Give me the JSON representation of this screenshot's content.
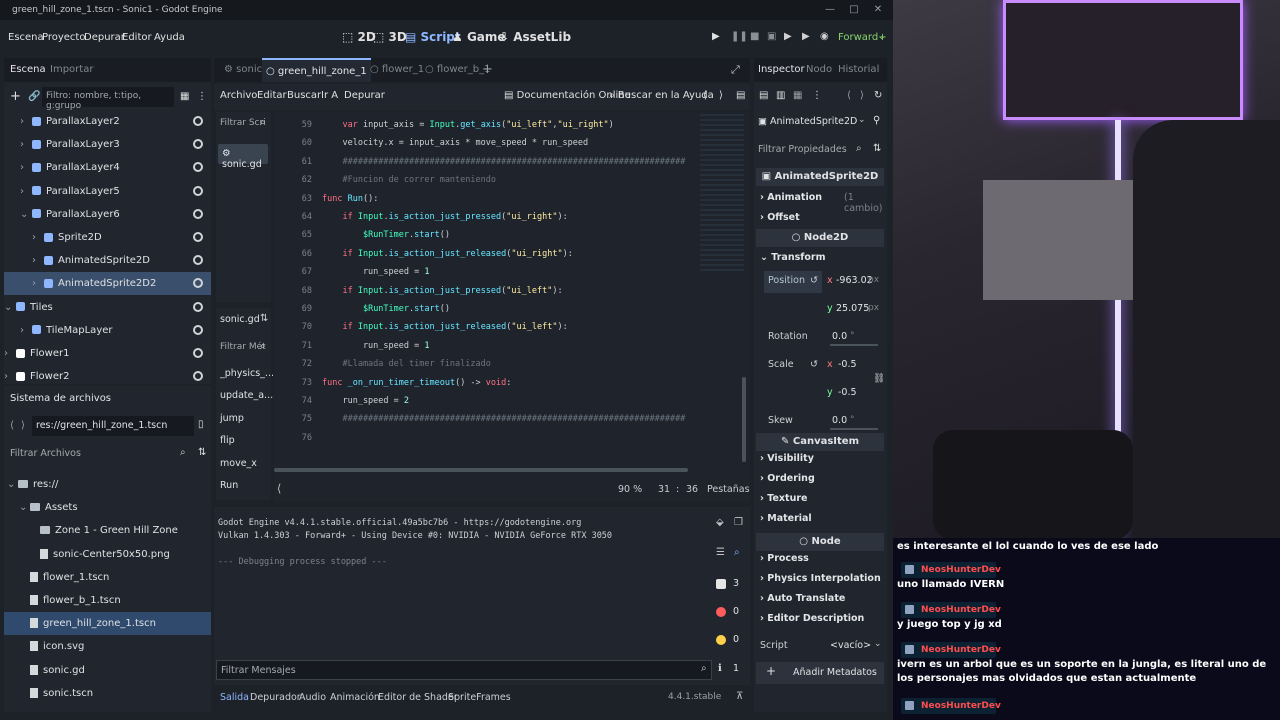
{
  "window": {
    "title": "green_hill_zone_1.tscn - Sonic1 - Godot Engine"
  },
  "menu": [
    "Escena",
    "Proyecto",
    "Depurar",
    "Editor",
    "Ayuda"
  ],
  "workspaces": [
    "2D",
    "3D",
    "Script",
    "Game",
    "AssetLib"
  ],
  "renderer": "Forward+",
  "scene_panel": {
    "tabs": [
      "Escena",
      "Importar"
    ],
    "filter_placeholder": "Filtro: nombre, t:tipo, g:grupo",
    "nodes": [
      "ParallaxLayer2",
      "ParallaxLayer3",
      "ParallaxLayer4",
      "ParallaxLayer5",
      "ParallaxLayer6",
      "Sprite2D",
      "AnimatedSprite2D",
      "AnimatedSprite2D2",
      "Tiles",
      "TileMapLayer",
      "Flower1",
      "Flower2"
    ]
  },
  "filesystem": {
    "title": "Sistema de archivos",
    "path": "res://green_hill_zone_1.tscn",
    "filter_placeholder": "Filtrar Archivos",
    "items": [
      "res://",
      "Assets",
      "Zone 1 - Green Hill Zone",
      "sonic-Center50x50.png",
      "flower_1.tscn",
      "flower_b_1.tscn",
      "green_hill_zone_1.tscn",
      "icon.svg",
      "sonic.gd",
      "sonic.tscn"
    ]
  },
  "editor_tabs": [
    "sonic",
    "green_hill_zone_1",
    "flower_1",
    "flower_b_1"
  ],
  "script_menu": [
    "Archivo",
    "Editar",
    "Buscar",
    "Ir A",
    "Depurar"
  ],
  "script_links": {
    "docs": "Documentación Online",
    "help": "Buscar en la Ayuda"
  },
  "scripts_list": {
    "filter_placeholder": "Filtrar Scri",
    "item": "sonic.gd"
  },
  "methods": {
    "file": "sonic.gd",
    "filter_placeholder": "Filtrar Mét",
    "items": [
      "_physics_...",
      "update_a...",
      "jump",
      "flip",
      "move_x",
      "Run"
    ]
  },
  "code_lines": [
    {
      "n": "59",
      "t": "    var input_axis = Input.get_axis(\"ui_left\",\"ui_right\")"
    },
    {
      "n": "60",
      "t": "    velocity.x = input_axis * move_speed * run_speed"
    },
    {
      "n": "61",
      "t": "    ###################################################################"
    },
    {
      "n": "62",
      "t": "    #Funcion de correr manteniendo"
    },
    {
      "n": "63",
      "t": "func Run():"
    },
    {
      "n": "64",
      "t": "    if Input.is_action_just_pressed(\"ui_right\"):"
    },
    {
      "n": "65",
      "t": "        $RunTimer.start()"
    },
    {
      "n": "66",
      "t": "    if Input.is_action_just_released(\"ui_right\"):"
    },
    {
      "n": "67",
      "t": "        run_speed = 1"
    },
    {
      "n": "68",
      "t": "    if Input.is_action_just_pressed(\"ui_left\"):"
    },
    {
      "n": "69",
      "t": "        $RunTimer.start()"
    },
    {
      "n": "70",
      "t": "    if Input.is_action_just_released(\"ui_left\"):"
    },
    {
      "n": "71",
      "t": "        run_speed = 1"
    },
    {
      "n": "72",
      "t": "    #Llamada del timer finalizado"
    },
    {
      "n": "73",
      "t": "func _on_run_timer_timeout() -> void:"
    },
    {
      "n": "74",
      "t": "    run_speed = 2"
    },
    {
      "n": "75",
      "t": "    ###################################################################"
    },
    {
      "n": "76",
      "t": ""
    }
  ],
  "status": {
    "zoom": "90 %",
    "line": "31",
    "col": "36",
    "tabs": "Pestañas"
  },
  "output": {
    "lines": [
      "Godot Engine v4.4.1.stable.official.49a5bc7b6 - https://godotengine.org",
      "Vulkan 1.4.303 - Forward+ - Using Device #0: NVIDIA - NVIDIA GeForce RTX 3050",
      "",
      "--- Debugging process stopped ---"
    ],
    "filter_placeholder": "Filtrar Mensajes",
    "counts": {
      "messages": "3",
      "errors": "0",
      "warnings": "0",
      "info": "1"
    }
  },
  "bottom_tabs": [
    "Salida",
    "Depurador",
    "Audio",
    "Animación",
    "Editor de Shader",
    "SpriteFrames"
  ],
  "version": "4.4.1.stable",
  "inspector": {
    "tabs": [
      "Inspector",
      "Nodo",
      "Historial"
    ],
    "object": "AnimatedSprite2D",
    "filter_placeholder": "Filtrar Propiedades",
    "class_header": "AnimatedSprite2D",
    "animation": {
      "label": "Animation",
      "note": "(1 cambio)"
    },
    "offset": "Offset",
    "node2d": "Node2D",
    "transform": "Transform",
    "position": {
      "label": "Position",
      "x": "-963.02",
      "y": "25.075",
      "unit": "px"
    },
    "rotation": {
      "label": "Rotation",
      "value": "0.0",
      "unit": "°"
    },
    "scale": {
      "label": "Scale",
      "x": "-0.5",
      "y": "-0.5"
    },
    "skew": {
      "label": "Skew",
      "value": "0.0",
      "unit": "°"
    },
    "canvasitem": "CanvasItem",
    "canvas_sections": [
      "Visibility",
      "Ordering",
      "Texture",
      "Material"
    ],
    "node": "Node",
    "node_sections": [
      "Process",
      "Physics Interpolation",
      "Auto Translate",
      "Editor Description"
    ],
    "script": {
      "label": "Script",
      "value": "<vacío>"
    },
    "add_meta": "Añadir Metadatos"
  },
  "chat": {
    "top_message": "es interesante el lol cuando lo ves de ese lado",
    "messages": [
      {
        "user": "NeosHunterDev",
        "text": "uno llamado IVERN"
      },
      {
        "user": "NeosHunterDev",
        "text": "y juego top y jg xd"
      },
      {
        "user": "NeosHunterDev",
        "text": "ivern es un arbol que es un soporte en la jungla, es literal uno de los personajes mas olvidados que estan actualmente"
      },
      {
        "user": "NeosHunterDev",
        "text": ""
      }
    ]
  },
  "colors": {
    "accent": "#8eb7ff",
    "selection": "#3a4f6b",
    "chat_user": "#ff4d4d"
  }
}
